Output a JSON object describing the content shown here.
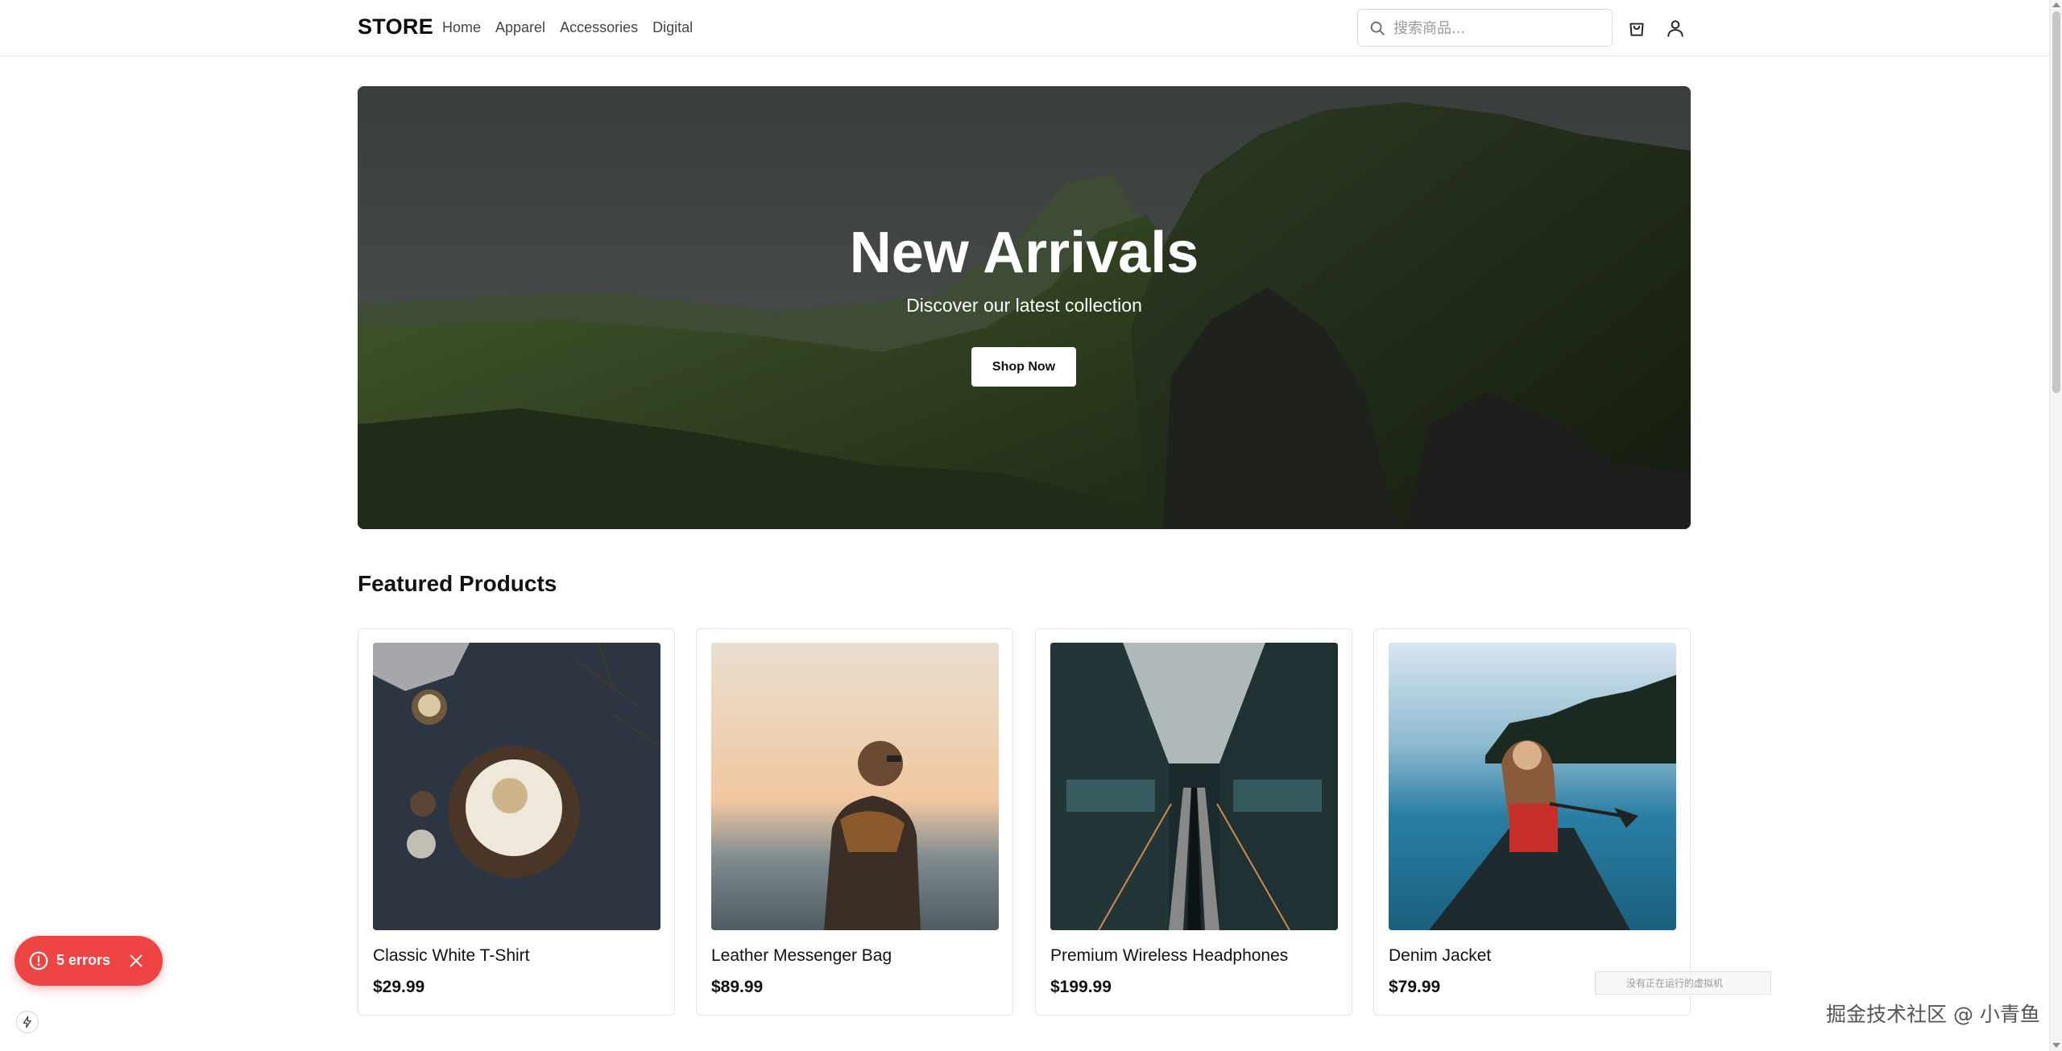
{
  "header": {
    "logo": "STORE",
    "nav": [
      "Home",
      "Apparel",
      "Accessories",
      "Digital"
    ],
    "search_placeholder": "搜索商品...",
    "icons": [
      "search-icon",
      "shopping-bag-icon",
      "user-icon"
    ]
  },
  "hero": {
    "title": "New Arrivals",
    "subtitle": "Discover our latest collection",
    "button": "Shop Now"
  },
  "featured": {
    "title": "Featured Products",
    "products": [
      {
        "name": "Classic White T-Shirt",
        "price": "$29.99"
      },
      {
        "name": "Leather Messenger Bag",
        "price": "$89.99"
      },
      {
        "name": "Premium Wireless Headphones",
        "price": "$199.99"
      },
      {
        "name": "Denim Jacket",
        "price": "$79.99"
      }
    ]
  },
  "dev_overlay": {
    "errors_label": "5 errors",
    "tooltip": "没有正在运行的虚拟机"
  },
  "watermark": "掘金技术社区 @ 小青鱼",
  "colors": {
    "error": "#ef4444",
    "text": "#111111",
    "border": "#e4e4e4"
  }
}
